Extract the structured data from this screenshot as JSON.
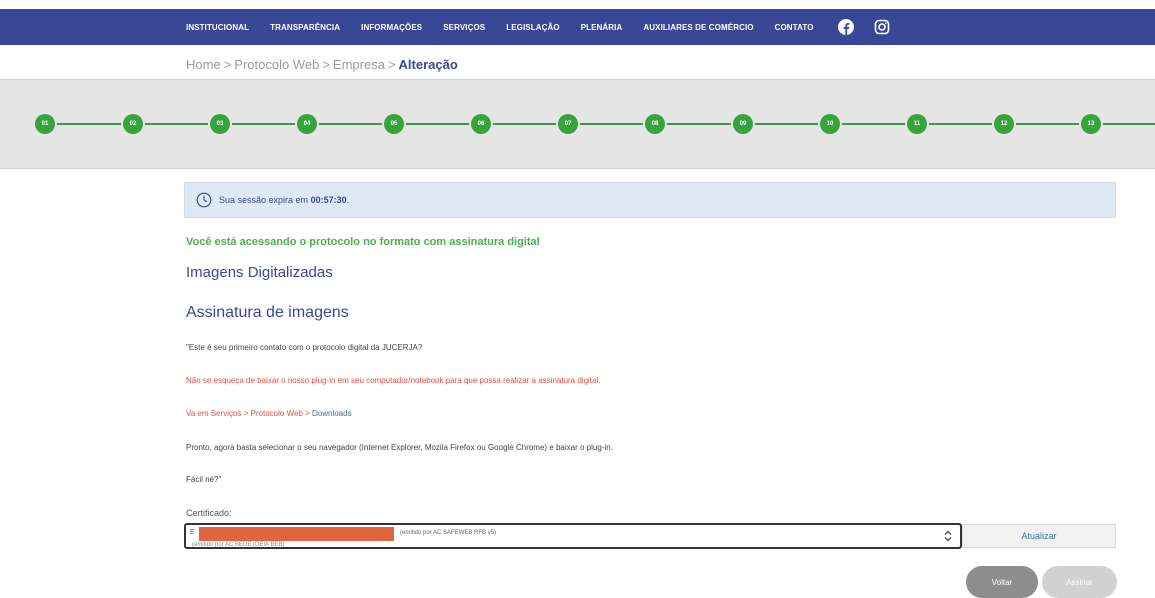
{
  "nav": {
    "items": [
      {
        "label": "INSTITUCIONAL"
      },
      {
        "label": "TRANSPARÊNCIA"
      },
      {
        "label": "INFORMAÇÕES"
      },
      {
        "label": "SERVIÇOS"
      },
      {
        "label": "LEGISLAÇÃO"
      },
      {
        "label": "PLENÁRIA"
      },
      {
        "label": "AUXILIARES DE COMÉRCIO"
      },
      {
        "label": "CONTATO"
      }
    ],
    "social": [
      "facebook-icon",
      "instagram-icon"
    ],
    "bg_color": "#3a4796"
  },
  "breadcrumb": {
    "home": "Home",
    "sep": ">",
    "protocolo": "Protocolo Web",
    "empresa": "Empresa",
    "current": "Alteração"
  },
  "steps": [
    "01",
    "02",
    "03",
    "04",
    "05",
    "06",
    "07",
    "08",
    "09",
    "10",
    "11",
    "12",
    "13"
  ],
  "session": {
    "prefix": "Sua sessão expira em",
    "time": "00:57:30",
    "suffix": "."
  },
  "content": {
    "green_msg": "Você está acessando o protocolo no formato com assinatura digital",
    "heading_images": "Imagens Digitalizadas",
    "heading_sign": "Assinatura de imagens",
    "p1": "\"Este é seu primeiro contato com o protocolo digital da JUCERJA?",
    "p2": "Não se esqueça de baixar o nosso plug-in em seu computador/notebook para que possa realizar a assinatura digital.",
    "p3_prefix": "Va em Serviços > Protocolo Web >",
    "p3_link": "Downloads",
    "p4": "Pronto, agora basta selecionar o seu navegador (Internet Explorer, Mozila Firefox ou Google Chrome) e baixar o plug-in.",
    "p5": "Fácil né?\""
  },
  "certificate": {
    "label": "Certificado:",
    "selected_prefix": "E",
    "selected_issuer": "(emitido por AC SAFEWEB RFB v5)",
    "other_option": "(emitido por AC BEDE (DEIA BEB)",
    "refresh_label": "Atualizar"
  },
  "actions": {
    "back_label": "Voltar",
    "sign_label": "Assinar"
  },
  "colors": {
    "accent": "#3a4796",
    "step_green": "#38a33d",
    "success_text": "#4caf50",
    "warning_text": "#e74c3c",
    "alert_bg": "#dfe9f5",
    "redaction": "#e0653f"
  }
}
